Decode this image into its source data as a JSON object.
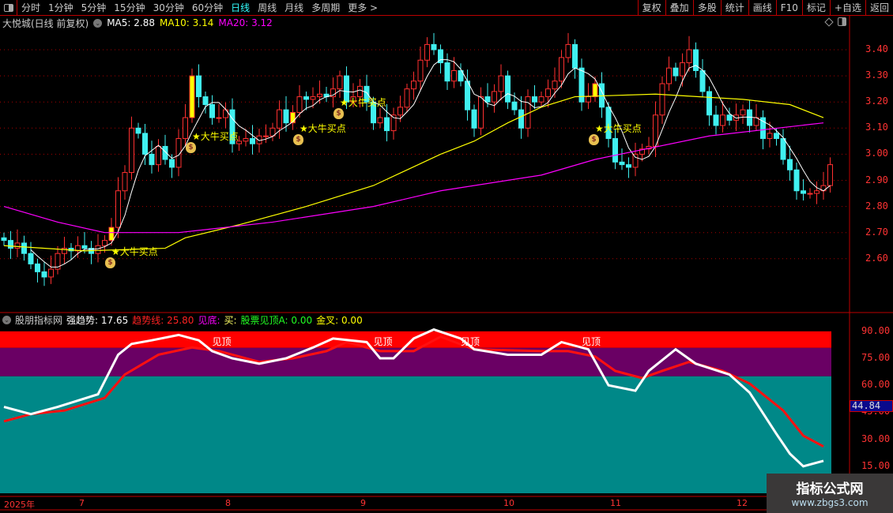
{
  "toolbar": {
    "periods": [
      "分时",
      "1分钟",
      "5分钟",
      "15分钟",
      "30分钟",
      "60分钟",
      "日线",
      "周线",
      "月线",
      "多周期",
      "更多 >"
    ],
    "active": "日线",
    "actions": [
      "复权",
      "叠加",
      "多股",
      "统计",
      "画线",
      "F10",
      "标记",
      "+自选",
      "返回"
    ]
  },
  "info": {
    "title": "大悦城(日线 前复权)",
    "ma5": "MA5: 2.88",
    "ma10": "MA10: 3.14",
    "ma20": "MA20: 3.12"
  },
  "colors": {
    "up": "#ff3030",
    "down": "#40f0f0",
    "ma5": "#ffffff",
    "ma10": "#ffff00",
    "ma20": "#ff00ff",
    "highlight": "#ffff00"
  },
  "price_axis": [
    "3.40",
    "3.30",
    "3.20",
    "3.10",
    "3.00",
    "2.90",
    "2.80",
    "2.70",
    "2.60"
  ],
  "closes": [
    2.67,
    2.64,
    2.66,
    2.62,
    2.58,
    2.55,
    2.53,
    2.56,
    2.62,
    2.64,
    2.63,
    2.65,
    2.64,
    2.62,
    2.65,
    2.67,
    2.72,
    2.86,
    2.93,
    3.1,
    3.08,
    3.0,
    2.96,
    3.03,
    2.98,
    2.95,
    3.06,
    3.14,
    3.3,
    3.22,
    3.19,
    3.14,
    3.14,
    3.17,
    3.04,
    3.05,
    3.06,
    3.04,
    3.07,
    3.07,
    3.1,
    3.17,
    3.12,
    3.16,
    3.22,
    3.21,
    3.22,
    3.23,
    3.22,
    3.25,
    3.3,
    3.2,
    3.22,
    3.26,
    3.2,
    3.12,
    3.14,
    3.09,
    3.15,
    3.18,
    3.25,
    3.28,
    3.36,
    3.42,
    3.4,
    3.35,
    3.28,
    3.32,
    3.28,
    3.17,
    3.1,
    3.22,
    3.2,
    3.24,
    3.3,
    3.2,
    3.17,
    3.1,
    3.22,
    3.2,
    3.22,
    3.25,
    3.28,
    3.37,
    3.42,
    3.33,
    3.2,
    3.22,
    3.27,
    3.18,
    3.06,
    2.97,
    2.96,
    2.95,
    3.0,
    3.02,
    3.03,
    3.15,
    3.27,
    3.33,
    3.3,
    3.35,
    3.4,
    3.32,
    3.24,
    3.15,
    3.11,
    3.15,
    3.13,
    3.15,
    3.17,
    3.11,
    3.14,
    3.06,
    3.08,
    3.06,
    2.98,
    2.94,
    2.86,
    2.85,
    2.85,
    2.86,
    2.88,
    2.96
  ],
  "highlight_indices": [
    16,
    28,
    43,
    88
  ],
  "ma10_points": [
    [
      0,
      2.65
    ],
    [
      12,
      2.63
    ],
    [
      24,
      2.64
    ],
    [
      27,
      2.68
    ],
    [
      35,
      2.73
    ],
    [
      45,
      2.8
    ],
    [
      55,
      2.88
    ],
    [
      65,
      3.0
    ],
    [
      70,
      3.05
    ],
    [
      75,
      3.12
    ],
    [
      80,
      3.18
    ],
    [
      85,
      3.22
    ],
    [
      97,
      3.23
    ],
    [
      110,
      3.21
    ],
    [
      117,
      3.19
    ],
    [
      122,
      3.14
    ]
  ],
  "ma20_points": [
    [
      0,
      2.8
    ],
    [
      8,
      2.74
    ],
    [
      15,
      2.7
    ],
    [
      26,
      2.7
    ],
    [
      40,
      2.74
    ],
    [
      55,
      2.8
    ],
    [
      65,
      2.86
    ],
    [
      80,
      2.92
    ],
    [
      88,
      2.98
    ],
    [
      105,
      3.07
    ],
    [
      122,
      3.12
    ]
  ],
  "signals": [
    {
      "index": 16,
      "price": 2.63,
      "label": "★大牛买点"
    },
    {
      "index": 28,
      "price": 3.07,
      "label": "★大牛买点"
    },
    {
      "index": 44,
      "price": 3.1,
      "label": "★大牛买点"
    },
    {
      "index": 50,
      "price": 3.2,
      "label": "★大牛买点"
    },
    {
      "index": 88,
      "price": 3.1,
      "label": "★大牛买点"
    }
  ],
  "lower": {
    "name": "股朋指标网",
    "strong": "强趋势: 17.65",
    "trend": "趋势线: 25.80",
    "bottom": "见底:",
    "buy": "买:",
    "top_a": "股票见顶A: 0.00",
    "golden": "金叉: 0.00",
    "axis": [
      "90.00",
      "75.00",
      "60.00",
      "45.00",
      "30.00",
      "15.00"
    ],
    "current": "44.84",
    "top_label": "见顶",
    "top_indices": [
      31,
      55,
      68,
      86
    ],
    "strong_series": [
      [
        0,
        48
      ],
      [
        4,
        44
      ],
      [
        8,
        48
      ],
      [
        14,
        55
      ],
      [
        17,
        77
      ],
      [
        19,
        83
      ],
      [
        22,
        85
      ],
      [
        26,
        88
      ],
      [
        29,
        85
      ],
      [
        31,
        79
      ],
      [
        34,
        75
      ],
      [
        38,
        72
      ],
      [
        42,
        75
      ],
      [
        46,
        81
      ],
      [
        49,
        86
      ],
      [
        54,
        84
      ],
      [
        56,
        75
      ],
      [
        58,
        75
      ],
      [
        61,
        86
      ],
      [
        64,
        91
      ],
      [
        68,
        86
      ],
      [
        70,
        80
      ],
      [
        75,
        77
      ],
      [
        80,
        77
      ],
      [
        83,
        84
      ],
      [
        87,
        80
      ],
      [
        90,
        60
      ],
      [
        94,
        57
      ],
      [
        96,
        68
      ],
      [
        100,
        80
      ],
      [
        103,
        72
      ],
      [
        108,
        66
      ],
      [
        111,
        56
      ],
      [
        115,
        33
      ],
      [
        117,
        22
      ],
      [
        119,
        15
      ],
      [
        122,
        18
      ]
    ],
    "trend_series": [
      [
        0,
        40
      ],
      [
        4,
        44
      ],
      [
        9,
        46
      ],
      [
        15,
        53
      ],
      [
        18,
        66
      ],
      [
        23,
        77
      ],
      [
        28,
        81
      ],
      [
        32,
        79
      ],
      [
        38,
        73
      ],
      [
        43,
        75
      ],
      [
        48,
        79
      ],
      [
        51,
        84
      ],
      [
        56,
        79
      ],
      [
        61,
        79
      ],
      [
        65,
        87
      ],
      [
        70,
        80
      ],
      [
        80,
        79
      ],
      [
        84,
        79
      ],
      [
        88,
        76
      ],
      [
        91,
        68
      ],
      [
        95,
        64
      ],
      [
        98,
        68
      ],
      [
        102,
        73
      ],
      [
        107,
        68
      ],
      [
        111,
        61
      ],
      [
        116,
        46
      ],
      [
        119,
        32
      ],
      [
        122,
        26
      ]
    ]
  },
  "dates": [
    "2025年",
    "7",
    "8",
    "9",
    "10",
    "11",
    "12"
  ],
  "watermark": {
    "line1": "指标公式网",
    "line2": "www.zbgs3.com"
  }
}
